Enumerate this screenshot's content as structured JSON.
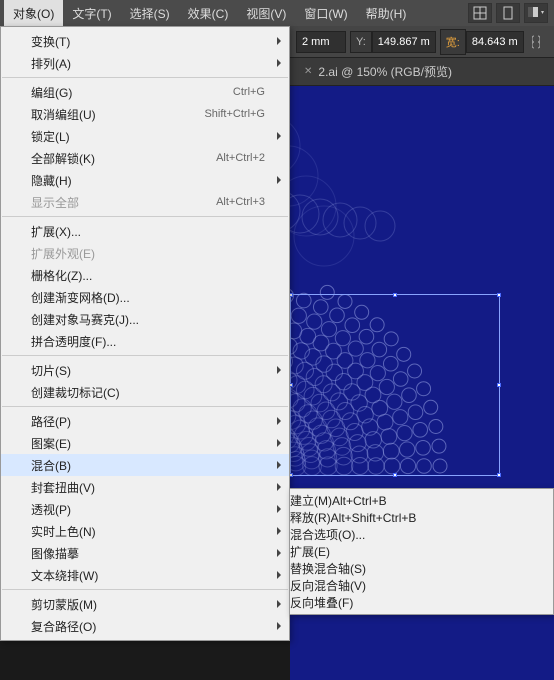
{
  "menubar": {
    "items": [
      "对象(O)",
      "文字(T)",
      "选择(S)",
      "效果(C)",
      "视图(V)",
      "窗口(W)",
      "帮助(H)"
    ],
    "active_index": 0
  },
  "propbar": {
    "x_suffix": "2 mm",
    "y_label": "Y:",
    "y_value": "149.867 m",
    "w_label": "宽:",
    "w_value": "84.643 m"
  },
  "tabs": {
    "active": {
      "label": "2.ai @ 150% (RGB/预览)"
    }
  },
  "dropdown": {
    "groups": [
      [
        {
          "label": "变换(T)",
          "sub": true
        },
        {
          "label": "排列(A)",
          "sub": true
        }
      ],
      [
        {
          "label": "编组(G)",
          "shortcut": "Ctrl+G"
        },
        {
          "label": "取消编组(U)",
          "shortcut": "Shift+Ctrl+G"
        },
        {
          "label": "锁定(L)",
          "sub": true
        },
        {
          "label": "全部解锁(K)",
          "shortcut": "Alt+Ctrl+2"
        },
        {
          "label": "隐藏(H)",
          "sub": true
        },
        {
          "label": "显示全部",
          "shortcut": "Alt+Ctrl+3",
          "disabled": true
        }
      ],
      [
        {
          "label": "扩展(X)..."
        },
        {
          "label": "扩展外观(E)",
          "disabled": true
        },
        {
          "label": "栅格化(Z)..."
        },
        {
          "label": "创建渐变网格(D)..."
        },
        {
          "label": "创建对象马赛克(J)..."
        },
        {
          "label": "拼合透明度(F)..."
        }
      ],
      [
        {
          "label": "切片(S)",
          "sub": true
        },
        {
          "label": "创建裁切标记(C)"
        }
      ],
      [
        {
          "label": "路径(P)",
          "sub": true
        },
        {
          "label": "图案(E)",
          "sub": true
        },
        {
          "label": "混合(B)",
          "sub": true,
          "highlighted": true
        },
        {
          "label": "封套扭曲(V)",
          "sub": true
        },
        {
          "label": "透视(P)",
          "sub": true
        },
        {
          "label": "实时上色(N)",
          "sub": true
        },
        {
          "label": "图像描摹",
          "sub": true
        },
        {
          "label": "文本绕排(W)",
          "sub": true
        }
      ],
      [
        {
          "label": "剪切蒙版(M)",
          "sub": true
        },
        {
          "label": "复合路径(O)",
          "sub": true
        }
      ]
    ]
  },
  "submenu": {
    "groups": [
      [
        {
          "label": "建立(M)",
          "shortcut": "Alt+Ctrl+B"
        },
        {
          "label": "释放(R)",
          "shortcut": "Alt+Shift+Ctrl+B"
        }
      ],
      [
        {
          "label": "混合选项(O)..."
        }
      ],
      [
        {
          "label": "扩展(E)",
          "highlighted": true
        }
      ],
      [
        {
          "label": "替换混合轴(S)",
          "disabled": true
        },
        {
          "label": "反向混合轴(V)"
        },
        {
          "label": "反向堆叠(F)"
        }
      ]
    ]
  }
}
